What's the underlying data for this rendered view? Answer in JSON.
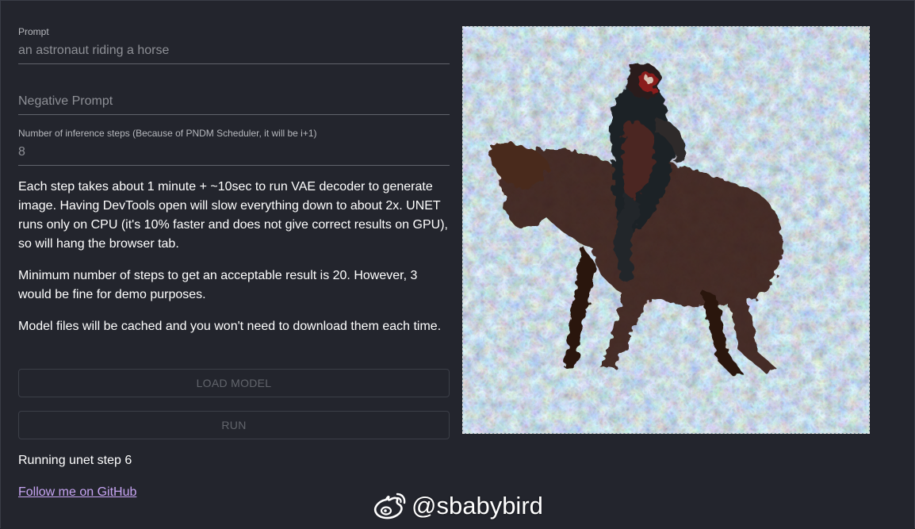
{
  "prompt_field": {
    "label": "Prompt",
    "value": "an astronaut riding a horse"
  },
  "negative_prompt_field": {
    "placeholder": "Negative Prompt"
  },
  "steps_field": {
    "label": "Number of inference steps (Because of PNDM Scheduler, it will be i+1)",
    "value": "8"
  },
  "descriptions": [
    "Each step takes about 1 minute + ~10sec to run VAE decoder to generate image. Having DevTools open will slow everything down to about 2x. UNET runs only on CPU (it's 10% faster and does not give correct results on GPU), so will hang the browser tab.",
    "Minimum number of steps to get an acceptable result is 20. However, 3 would be fine for demo purposes.",
    "Model files will be cached and you won't need to download them each time."
  ],
  "buttons": {
    "load_model": "LOAD MODEL",
    "run": "RUN"
  },
  "status_text": "Running unet step 6",
  "github_link": "Follow me on GitHub",
  "watermark": {
    "icon": "weibo-icon",
    "text": "@sbabybird"
  },
  "generated_image": {
    "description_icon": "astronaut-on-horse-image"
  },
  "colors": {
    "background": "#23252d",
    "link": "#c6a4f2",
    "field_line": "#61646c"
  }
}
